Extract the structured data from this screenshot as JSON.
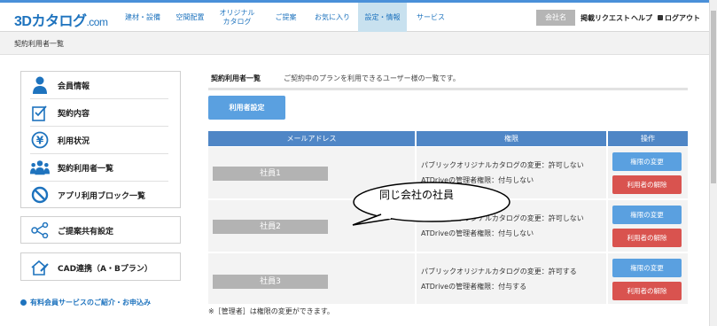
{
  "header": {
    "logo_main": "3Dカタログ",
    "logo_suffix": ".com",
    "nav": [
      {
        "label": "建材・設備"
      },
      {
        "label": "空間配置"
      },
      {
        "label": "オリジナル カタログ"
      },
      {
        "label": "ご提案"
      },
      {
        "label": "お気に入り"
      },
      {
        "label": "設定・情報"
      },
      {
        "label": "サービス"
      }
    ],
    "company_label": "会社名",
    "post_request": "掲載リクエスト",
    "help": "ヘルプ",
    "logout": "ログアウト"
  },
  "breadcrumb": "契約利用者一覧",
  "sidebar": {
    "items": [
      {
        "label": "会員情報"
      },
      {
        "label": "契約内容"
      },
      {
        "label": "利用状況"
      },
      {
        "label": "契約利用者一覧"
      },
      {
        "label": "アプリ利用ブロック一覧"
      }
    ],
    "share": "ご提案共有設定",
    "cad": "CAD連携（A・Bプラン）",
    "paid_link": "有料会員サービスのご紹介・お申込み"
  },
  "main": {
    "heading": "契約利用者一覧",
    "description": "ご契約中のプランを利用できるユーザー様の一覧です。",
    "settings_button": "利用者設定",
    "columns": [
      "メールアドレス",
      "権限",
      "操作"
    ],
    "rows": [
      {
        "name": "社員1",
        "perm1": "パブリックオリジナルカタログの変更：許可しない",
        "perm2": "ATDriveの管理者権限：付与しない"
      },
      {
        "name": "社員2",
        "perm1": "パブリックオリジナルカタログの変更：許可しない",
        "perm2": "ATDriveの管理者権限：付与しない"
      },
      {
        "name": "社員3",
        "perm1": "パブリックオリジナルカタログの変更：許可する",
        "perm2": "ATDriveの管理者権限：付与する"
      }
    ],
    "change_button": "権限の変更",
    "remove_button": "利用者の解除",
    "note": "※［管理者］は権限の変更ができます。"
  },
  "callout": "同じ会社の社員",
  "colors": {
    "accent": "#4f86c6",
    "danger": "#d9534f",
    "button": "#5aa0e0"
  }
}
